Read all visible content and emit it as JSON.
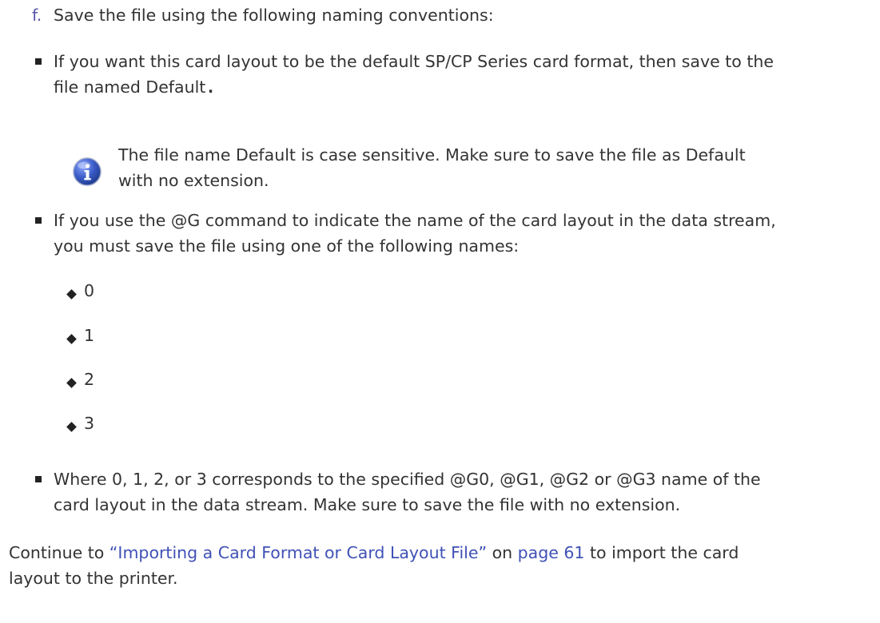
{
  "step": {
    "letter": "f.",
    "text": "Save the file using the following naming conventions:"
  },
  "bullet1": {
    "line1": "If you want this card layout to be the default SP/CP Series card format, then save to the",
    "line2": "file named Default",
    "line2_end": "."
  },
  "note": {
    "icon": "info-icon",
    "line1": "The file name Default is case sensitive. Make sure to save the file as Default",
    "line2": "with no extension."
  },
  "bullet2": {
    "line1": "If you use the @G command to indicate the name of the card layout in the data stream,",
    "line2": "you must save the file using one of the following names:"
  },
  "names": [
    "0",
    "1",
    "2",
    "3"
  ],
  "bullet3": {
    "line1": "Where 0, 1, 2, or 3 corresponds to the specified @G0, @G1, @G2 or @G3 name of the",
    "line2": "card layout in the data stream. Make sure to save the file with no extension."
  },
  "continue": {
    "prefix": "Continue to ",
    "link_text": "“Importing a Card Format or Card Layout File”",
    "mid": " on ",
    "page_link": "page 61",
    "suffix": " to import the card",
    "line2": "layout to the printer."
  },
  "colors": {
    "text": "#333333",
    "link": "#3f51b5",
    "step_letter": "#5a5aa8",
    "info_icon": "#3a5bc7"
  }
}
